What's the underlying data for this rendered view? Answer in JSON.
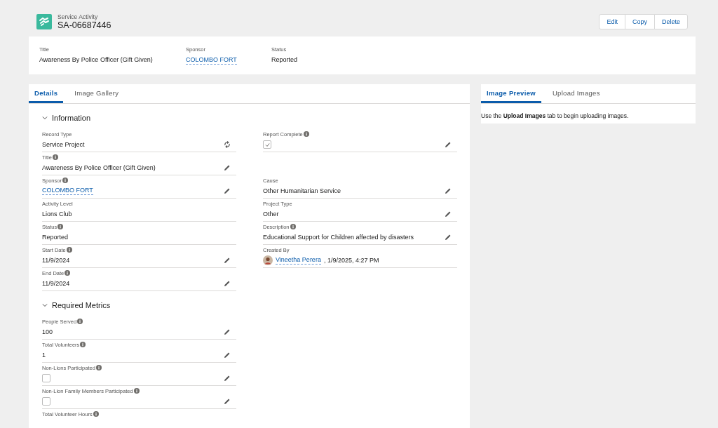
{
  "header": {
    "object": "Service Activity",
    "title": "SA-06687446",
    "buttons": [
      "Edit",
      "Copy",
      "Delete"
    ]
  },
  "highlights": [
    {
      "label": "Title",
      "value": "Awareness By Police Officer (Gift Given)",
      "kind": "text"
    },
    {
      "label": "Sponsor",
      "value": "COLOMBO FORT",
      "kind": "link"
    },
    {
      "label": "Status",
      "value": "Reported",
      "kind": "text"
    }
  ],
  "details_tabs": [
    {
      "label": "Details",
      "selected": true
    },
    {
      "label": "Image Gallery",
      "selected": false
    }
  ],
  "sections": [
    {
      "title": "Information",
      "expanded": true,
      "rows": [
        {
          "left": {
            "label": "Record Type",
            "info": false,
            "kind": "text",
            "value": "Service Project",
            "editable": false,
            "changeable": true
          },
          "right": {
            "label": "Report Complete",
            "info": true,
            "kind": "checkbox",
            "checked": true,
            "editable": true
          }
        },
        {
          "left": {
            "label": "Title",
            "info": true,
            "kind": "text",
            "value": "Awareness By Police Officer (Gift Given)",
            "editable": true
          }
        },
        {
          "left": {
            "label": "Sponsor",
            "info": true,
            "kind": "link",
            "value": "COLOMBO FORT",
            "editable": true
          },
          "right": {
            "label": "Cause",
            "info": false,
            "kind": "text",
            "value": "Other Humanitarian Service",
            "editable": true
          }
        },
        {
          "left": {
            "label": "Activity Level",
            "info": false,
            "kind": "text",
            "value": "Lions Club",
            "editable": false
          },
          "right": {
            "label": "Project Type",
            "info": false,
            "kind": "text",
            "value": "Other",
            "editable": true
          }
        },
        {
          "left": {
            "label": "Status",
            "info": true,
            "kind": "text",
            "value": "Reported",
            "editable": false
          },
          "right": {
            "label": "Description",
            "info": true,
            "kind": "text",
            "value": "Educational Support for Children affected by disasters",
            "editable": true
          }
        },
        {
          "left": {
            "label": "Start Date",
            "info": true,
            "kind": "text",
            "value": "11/9/2024",
            "editable": true
          },
          "right": {
            "label": "Created By",
            "info": false,
            "kind": "user",
            "value": "Vineetha Perera",
            "suffix": ", 1/9/2025, 4:27 PM",
            "editable": false
          }
        },
        {
          "left": {
            "label": "End Date",
            "info": true,
            "kind": "text",
            "value": "11/9/2024",
            "editable": true
          }
        }
      ]
    },
    {
      "title": "Required Metrics",
      "expanded": true,
      "rows": [
        {
          "left": {
            "label": "People Served",
            "info": true,
            "kind": "text",
            "value": "100",
            "editable": true
          }
        },
        {
          "left": {
            "label": "Total Volunteers",
            "info": true,
            "kind": "text",
            "value": "1",
            "editable": true
          }
        },
        {
          "left": {
            "label": "Non-Lions Participated",
            "info": true,
            "kind": "checkbox",
            "checked": false,
            "editable": true
          }
        },
        {
          "left": {
            "label": "Non-Lion Family Members Participated",
            "info": true,
            "kind": "checkbox",
            "checked": false,
            "editable": true
          }
        },
        {
          "left": {
            "label": "Total Volunteer Hours",
            "info": true,
            "kind": "label_only",
            "editable": false
          }
        }
      ]
    }
  ],
  "preview_tabs": [
    {
      "label": "Image Preview",
      "selected": true
    },
    {
      "label": "Upload Images",
      "selected": false
    }
  ],
  "preview_message": "Use the **Upload Images** tab to begin uploading images."
}
